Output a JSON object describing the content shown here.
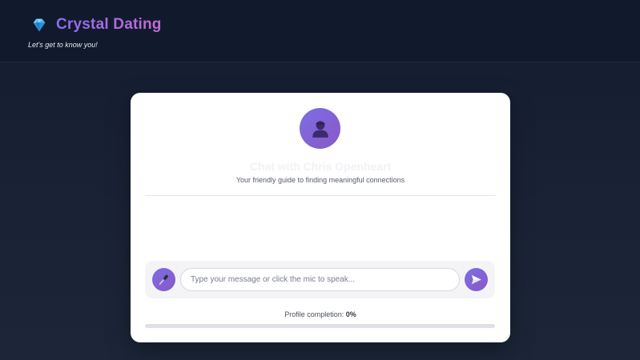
{
  "header": {
    "logo_icon": "gem-icon",
    "brand_name": "Crystal Dating",
    "tagline": "Let's get to know you!"
  },
  "chat": {
    "avatar_icon": "user-avatar-icon",
    "title": "Chat with Chris Openheart",
    "subtitle": "Your friendly guide to finding meaningful connections",
    "messages": []
  },
  "input_bar": {
    "mic_icon": "microphone-icon",
    "placeholder": "Type your message or click the mic to speak...",
    "value": "",
    "send_icon": "send-icon"
  },
  "profile": {
    "completion_label": "Profile completion:",
    "completion_value": "0%",
    "completion_fraction": 0
  },
  "colors": {
    "accent_start": "#7b6ee4",
    "accent_end": "#c56bd6",
    "header_bg": "#111a2c",
    "page_bg": "#1a2336"
  }
}
